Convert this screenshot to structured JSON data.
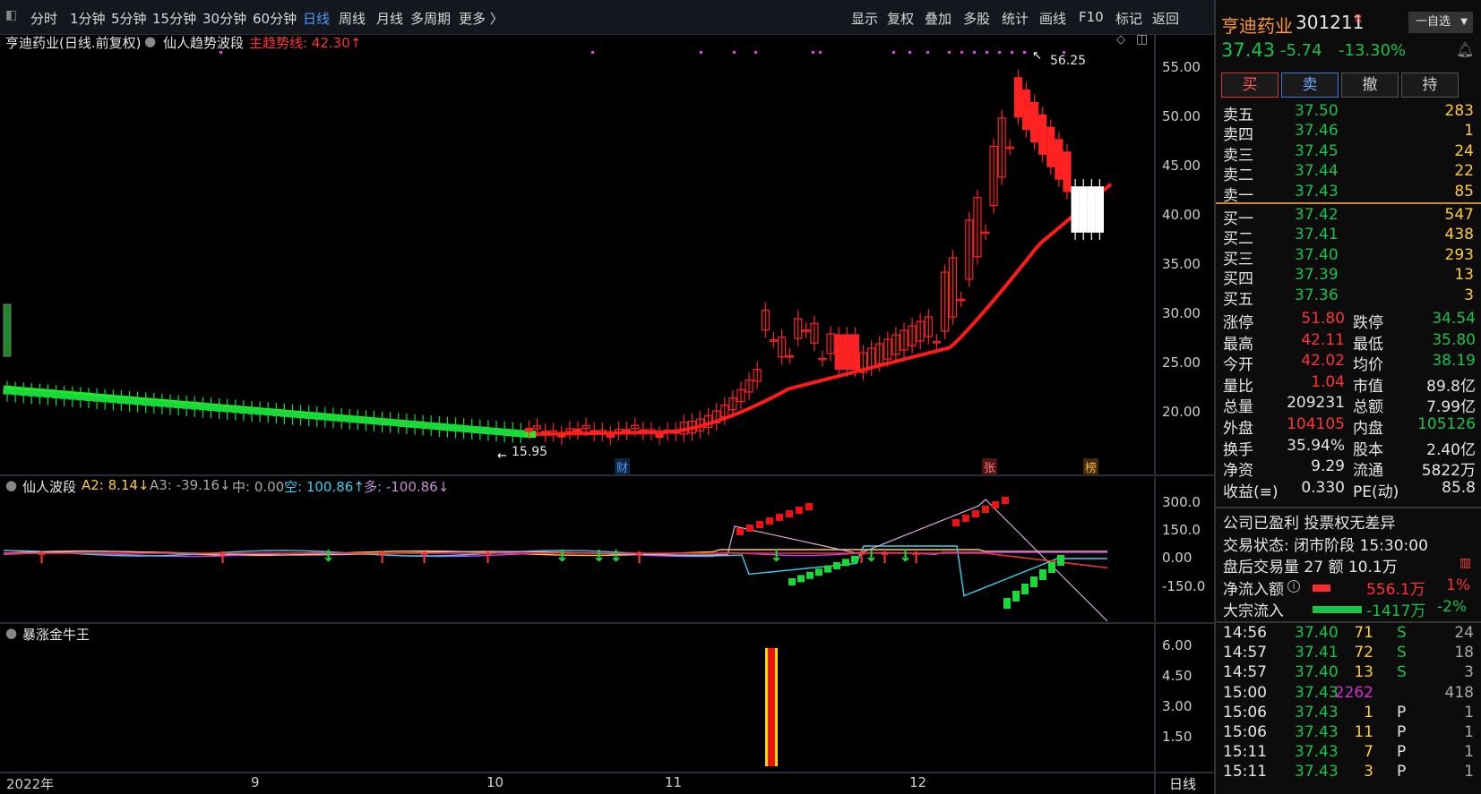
{
  "toolbar": {
    "periods": [
      "分时",
      "1分钟",
      "5分钟",
      "15分钟",
      "30分钟",
      "60分钟",
      "日线",
      "周线",
      "月线",
      "多周期",
      "更多 〉"
    ],
    "active_period": "日线",
    "tools": [
      "显示",
      "复权",
      "叠加",
      "多股",
      "统计",
      "画线",
      "F10",
      "标记",
      "返回"
    ]
  },
  "main_chart": {
    "title": "亨迪药业(日线.前复权)",
    "indicator_name": "仙人趋势波段",
    "trend_line_label": "主趋势线: 42.30↑",
    "price_axis": [
      "55.00",
      "50.00",
      "45.00",
      "40.00",
      "35.00",
      "30.00",
      "25.00",
      "20.00"
    ],
    "high_label": "56.25",
    "low_label": "15.95",
    "event_markers": [
      "财",
      "张",
      "榜"
    ]
  },
  "sub_chart1": {
    "name": "仙人波段",
    "a2": "A2: 8.14↓",
    "a3": "A3: -39.16↓",
    "mid": "中: 0.00",
    "kong": "空: 100.86↑",
    "duo": "多: -100.86↓",
    "axis": [
      "300.0",
      "150.0",
      "0.00",
      "-150.0"
    ]
  },
  "sub_chart2": {
    "name": "暴涨金牛王",
    "axis": [
      "6.00",
      "4.50",
      "3.00",
      "1.50"
    ]
  },
  "date_axis": [
    "2022年",
    "9",
    "10",
    "11",
    "12"
  ],
  "period_label": "日线",
  "quote": {
    "name": "亨迪药业",
    "code": "301211",
    "flag": "R",
    "watch_button": "自选",
    "price": "37.43",
    "change": "-5.74",
    "pct": "-13.30%",
    "trade_buttons": [
      "买",
      "卖",
      "撤",
      "持"
    ],
    "asks": [
      {
        "label": "卖五",
        "price": "37.50",
        "vol": "283"
      },
      {
        "label": "卖四",
        "price": "37.46",
        "vol": "1"
      },
      {
        "label": "卖三",
        "price": "37.45",
        "vol": "24"
      },
      {
        "label": "卖二",
        "price": "37.44",
        "vol": "22"
      },
      {
        "label": "卖一",
        "price": "37.43",
        "vol": "85"
      }
    ],
    "bids": [
      {
        "label": "买一",
        "price": "37.42",
        "vol": "547"
      },
      {
        "label": "买二",
        "price": "37.41",
        "vol": "438"
      },
      {
        "label": "买三",
        "price": "37.40",
        "vol": "293"
      },
      {
        "label": "买四",
        "price": "37.39",
        "vol": "13"
      },
      {
        "label": "买五",
        "price": "37.36",
        "vol": "3"
      }
    ],
    "stats": [
      {
        "l1": "涨停",
        "v1": "51.80",
        "l2": "跌停",
        "v2": "34.54"
      },
      {
        "l1": "最高",
        "v1": "42.11",
        "l2": "最低",
        "v2": "35.80"
      },
      {
        "l1": "今开",
        "v1": "42.02",
        "l2": "均价",
        "v2": "38.19"
      },
      {
        "l1": "量比",
        "v1": "1.04",
        "l2": "市值",
        "v2": "89.8亿"
      },
      {
        "l1": "总量",
        "v1": "209231",
        "l2": "总额",
        "v2": "7.99亿"
      },
      {
        "l1": "外盘",
        "v1": "104105",
        "l2": "内盘",
        "v2": "105126"
      },
      {
        "l1": "换手",
        "v1": "35.94%",
        "l2": "股本",
        "v2": "2.40亿"
      },
      {
        "l1": "净资",
        "v1": "9.29",
        "l2": "流通",
        "v2": "5822万"
      },
      {
        "l1": "收益(≡)",
        "v1": "0.330",
        "l2": "PE(动)",
        "v2": "85.8"
      }
    ],
    "notice": "公司已盈利 投票权无差异",
    "trade_status": "交易状态: 闭市阶段 15:30:00",
    "after_hours": "盘后交易量 27 额 10.1万",
    "net_inflow": {
      "label": "净流入额",
      "value": "556.1万",
      "pct": "1%"
    },
    "block_inflow": {
      "label": "大宗流入",
      "value": "-1417万",
      "pct": "-2%"
    },
    "ticks": [
      {
        "time": "14:56",
        "price": "37.40",
        "vol": "71",
        "flag": "S",
        "n": "24"
      },
      {
        "time": "14:57",
        "price": "37.41",
        "vol": "72",
        "flag": "S",
        "n": "18"
      },
      {
        "time": "14:57",
        "price": "37.40",
        "vol": "13",
        "flag": "S",
        "n": "3"
      },
      {
        "time": "15:00",
        "price": "37.43",
        "vol": "2262",
        "flag": "",
        "n": "418"
      },
      {
        "time": "15:06",
        "price": "37.43",
        "vol": "1",
        "flag": "P",
        "n": "1"
      },
      {
        "time": "15:06",
        "price": "37.43",
        "vol": "11",
        "flag": "P",
        "n": "1"
      },
      {
        "time": "15:11",
        "price": "37.43",
        "vol": "7",
        "flag": "P",
        "n": "1"
      },
      {
        "time": "15:11",
        "price": "37.43",
        "vol": "3",
        "flag": "P",
        "n": "1"
      }
    ]
  },
  "colors": {
    "up": "#ff2222",
    "down": "#19d93a",
    "trend_up": "#ff1a1a",
    "trend_down": "#22ee22",
    "accent": "#4d9cff"
  }
}
